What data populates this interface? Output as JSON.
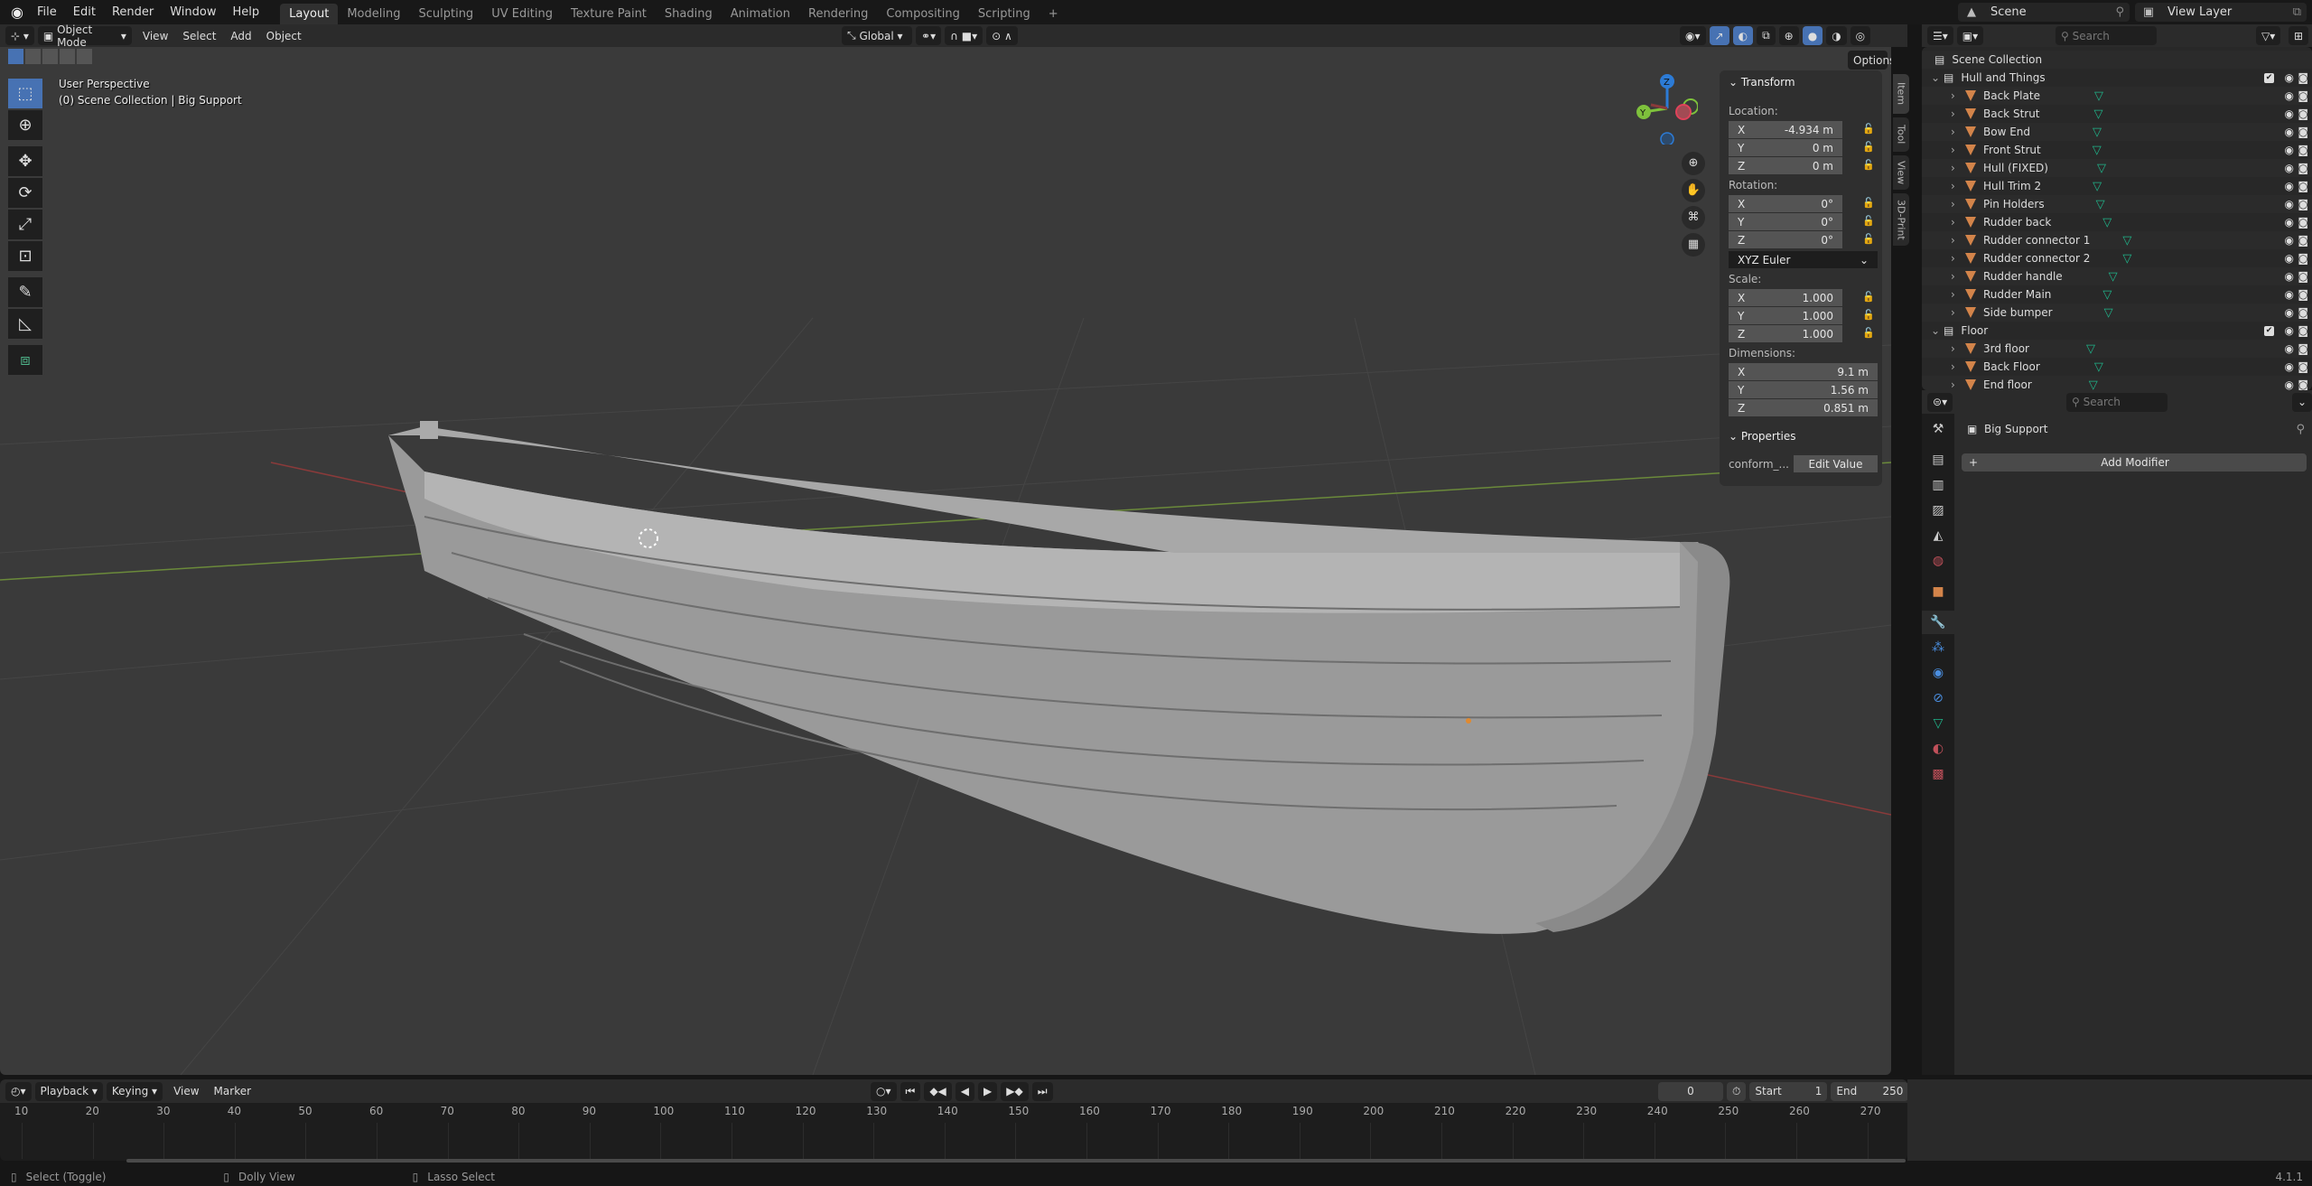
{
  "app": {
    "menus": [
      "File",
      "Edit",
      "Render",
      "Window",
      "Help"
    ],
    "workspaces": [
      "Layout",
      "Modeling",
      "Sculpting",
      "UV Editing",
      "Texture Paint",
      "Shading",
      "Animation",
      "Rendering",
      "Compositing",
      "Scripting"
    ],
    "active_workspace": "Layout",
    "add_workspace": "+",
    "scene": "Scene",
    "view_layer": "View Layer",
    "version": "4.1.1"
  },
  "viewport_header": {
    "mode": "Object Mode",
    "menus": [
      "View",
      "Select",
      "Add",
      "Object"
    ],
    "transform_orientation": "Global",
    "options_label": "Options"
  },
  "viewport": {
    "view_name": "User Perspective",
    "context": "(0) Scene Collection | Big Support",
    "gizmo_axes": [
      "X",
      "Y",
      "Z"
    ],
    "tools": [
      "select-box",
      "cursor",
      "move",
      "rotate",
      "scale",
      "transform",
      "annotate",
      "measure",
      "add-cube"
    ],
    "nav_buttons": [
      "zoom",
      "pan",
      "camera",
      "ortho-toggle"
    ]
  },
  "npanel": {
    "tabs": [
      "Item",
      "Tool",
      "View",
      "3D-Print"
    ],
    "transform_title": "Transform",
    "location_label": "Location:",
    "location": {
      "x": "-4.934 m",
      "y": "0 m",
      "z": "0 m"
    },
    "rotation_label": "Rotation:",
    "rotation": {
      "x": "0°",
      "y": "0°",
      "z": "0°"
    },
    "rotation_mode": "XYZ Euler",
    "scale_label": "Scale:",
    "scale": {
      "x": "1.000",
      "y": "1.000",
      "z": "1.000"
    },
    "dimensions_label": "Dimensions:",
    "dimensions": {
      "x": "9.1 m",
      "y": "1.56 m",
      "z": "0.851 m"
    },
    "properties_title": "Properties",
    "prop_name": "conform_...",
    "prop_button": "Edit Value",
    "axis": {
      "x": "X",
      "y": "Y",
      "z": "Z"
    }
  },
  "outliner": {
    "search_placeholder": "Search",
    "root": "Scene Collection",
    "collections": [
      {
        "name": "Hull and Things",
        "items": [
          "Back Plate",
          "Back Strut",
          "Bow End",
          "Front Strut",
          "Hull (FIXED)",
          "Hull Trim 2",
          "Pin Holders",
          "Rudder back",
          "Rudder connector 1",
          "Rudder connector 2",
          "Rudder handle",
          "Rudder Main",
          "Side bumper"
        ]
      },
      {
        "name": "Floor",
        "items": [
          "3rd floor",
          "Back Floor",
          "End floor"
        ]
      }
    ]
  },
  "properties": {
    "search_placeholder": "Search",
    "object_name": "Big Support",
    "add_modifier": "Add Modifier",
    "tabs": [
      "tool",
      "render",
      "output",
      "view-layer",
      "scene",
      "world",
      "object",
      "modifiers",
      "particles",
      "physics",
      "constraints",
      "data",
      "material",
      "texture"
    ],
    "active_tab": "modifiers"
  },
  "timeline": {
    "menus": [
      "Playback",
      "Keying",
      "View",
      "Marker"
    ],
    "current_frame": "0",
    "start_label": "Start",
    "start": "1",
    "end_label": "End",
    "end": "250",
    "ticks": [
      "10",
      "20",
      "30",
      "40",
      "50",
      "60",
      "70",
      "80",
      "90",
      "100",
      "110",
      "120",
      "130",
      "140",
      "150",
      "160",
      "170",
      "180",
      "190",
      "200",
      "210",
      "220",
      "230",
      "240",
      "250",
      "260",
      "270"
    ]
  },
  "statusbar": {
    "hints": [
      "Select (Toggle)",
      "Dolly View",
      "Lasso Select"
    ]
  },
  "colors": {
    "accent": "#4772b3",
    "mesh_icon": "#d3844a",
    "mesh_data": "#1fb58a",
    "x_axis": "#e0425a",
    "y_axis": "#7ec13c",
    "z_axis": "#2c7bd6"
  }
}
